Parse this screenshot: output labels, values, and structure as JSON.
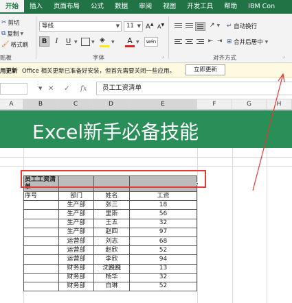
{
  "ribbon_tabs": [
    "开始",
    "插入",
    "页面布局",
    "公式",
    "数据",
    "审阅",
    "视图",
    "开发工具",
    "帮助",
    "IBM Con"
  ],
  "clipboard": {
    "cut": "剪切",
    "copy": "复制",
    "format_painter": "格式刷",
    "group_label": "贴板"
  },
  "font": {
    "name": "等线",
    "size": "11",
    "group_label": "字体",
    "bold": "B",
    "italic": "I",
    "underline": "U",
    "font_color_letter": "A",
    "phonetic": "wén"
  },
  "alignment": {
    "wrap_text": "自动换行",
    "merge_center": "合并后居中",
    "group_label": "对齐方式"
  },
  "message_bar": {
    "title": "用更新",
    "text": "Office 相关更新已准备好安装，但首先需要关闭一些应用。",
    "button": "立即更新"
  },
  "formula_bar": {
    "cancel": "✕",
    "enter": "✓",
    "fx": "fx",
    "content": "员工工资清单"
  },
  "columns": [
    "A",
    "B",
    "C",
    "D",
    "E",
    "F",
    "G",
    "H"
  ],
  "banner": "Excel新手必备技能",
  "table": {
    "title": "员工工资清单",
    "headers": [
      "序号",
      "部门",
      "姓名",
      "工资"
    ],
    "rows": [
      [
        "",
        "生产部",
        "张三",
        "18"
      ],
      [
        "",
        "生产部",
        "里斯",
        "56"
      ],
      [
        "",
        "生产部",
        "王五",
        "32"
      ],
      [
        "",
        "生产部",
        "赵四",
        "97"
      ],
      [
        "",
        "运营部",
        "刘志",
        "68"
      ],
      [
        "",
        "运营部",
        "赵欣",
        "52"
      ],
      [
        "",
        "运营部",
        "李欣",
        "94"
      ],
      [
        "",
        "财务部",
        "沈巍巍",
        "13"
      ],
      [
        "",
        "财务部",
        "杨华",
        "32"
      ],
      [
        "",
        "财务部",
        "白琳",
        "52"
      ]
    ]
  },
  "colors": {
    "excel_green": "#217346",
    "banner_green": "#2a8e58",
    "highlight_red": "#e53935",
    "message_bg": "#fef9e1"
  }
}
